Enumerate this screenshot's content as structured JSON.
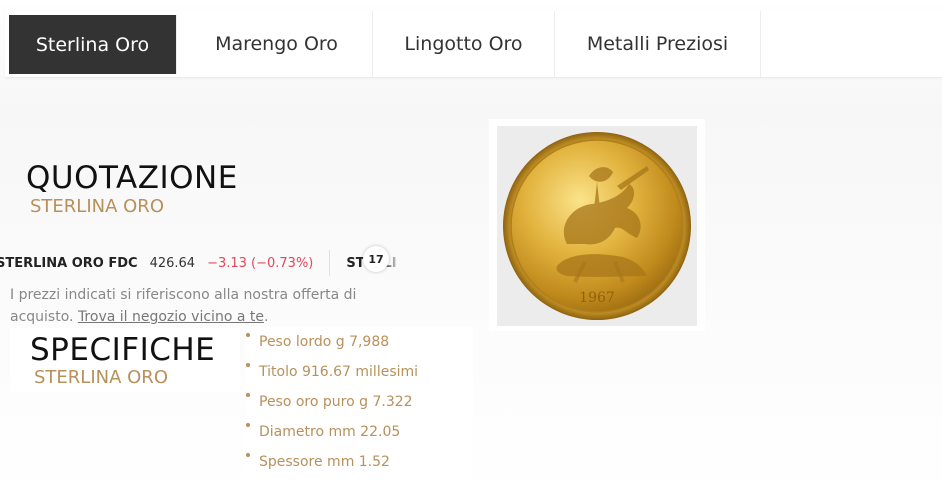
{
  "nav": {
    "tabs": [
      {
        "label": "Sterlina Oro",
        "active": true
      },
      {
        "label": "Marengo Oro",
        "active": false
      },
      {
        "label": "Lingotto Oro",
        "active": false
      },
      {
        "label": "Metalli Preziosi",
        "active": false
      }
    ]
  },
  "quotazione": {
    "title": "QUOTAZIONE",
    "subtitle": "STERLINA ORO"
  },
  "ticker": {
    "name": "STERLINA ORO FDC",
    "price": "426.64",
    "change": "−3.13 (−0.73%)",
    "next_name": "STERLI",
    "logo_text": "17"
  },
  "note": {
    "text": "I prezzi indicati si riferiscono alla nostra offerta di acquisto.",
    "link": "Trova il negozio vicino a te",
    "end": "."
  },
  "specifiche": {
    "title": "SPECIFICHE",
    "subtitle": "STERLINA ORO",
    "items": [
      "Peso lordo g 7,988",
      "Titolo 916.67 millesimi",
      "Peso oro puro g 7.322",
      "Diametro mm 22.05",
      "Spessore mm 1.52"
    ]
  },
  "coin": {
    "year": "1967"
  },
  "colors": {
    "accent_gold": "#b8905a",
    "active_tab": "#333333",
    "negative": "#e0475a"
  }
}
